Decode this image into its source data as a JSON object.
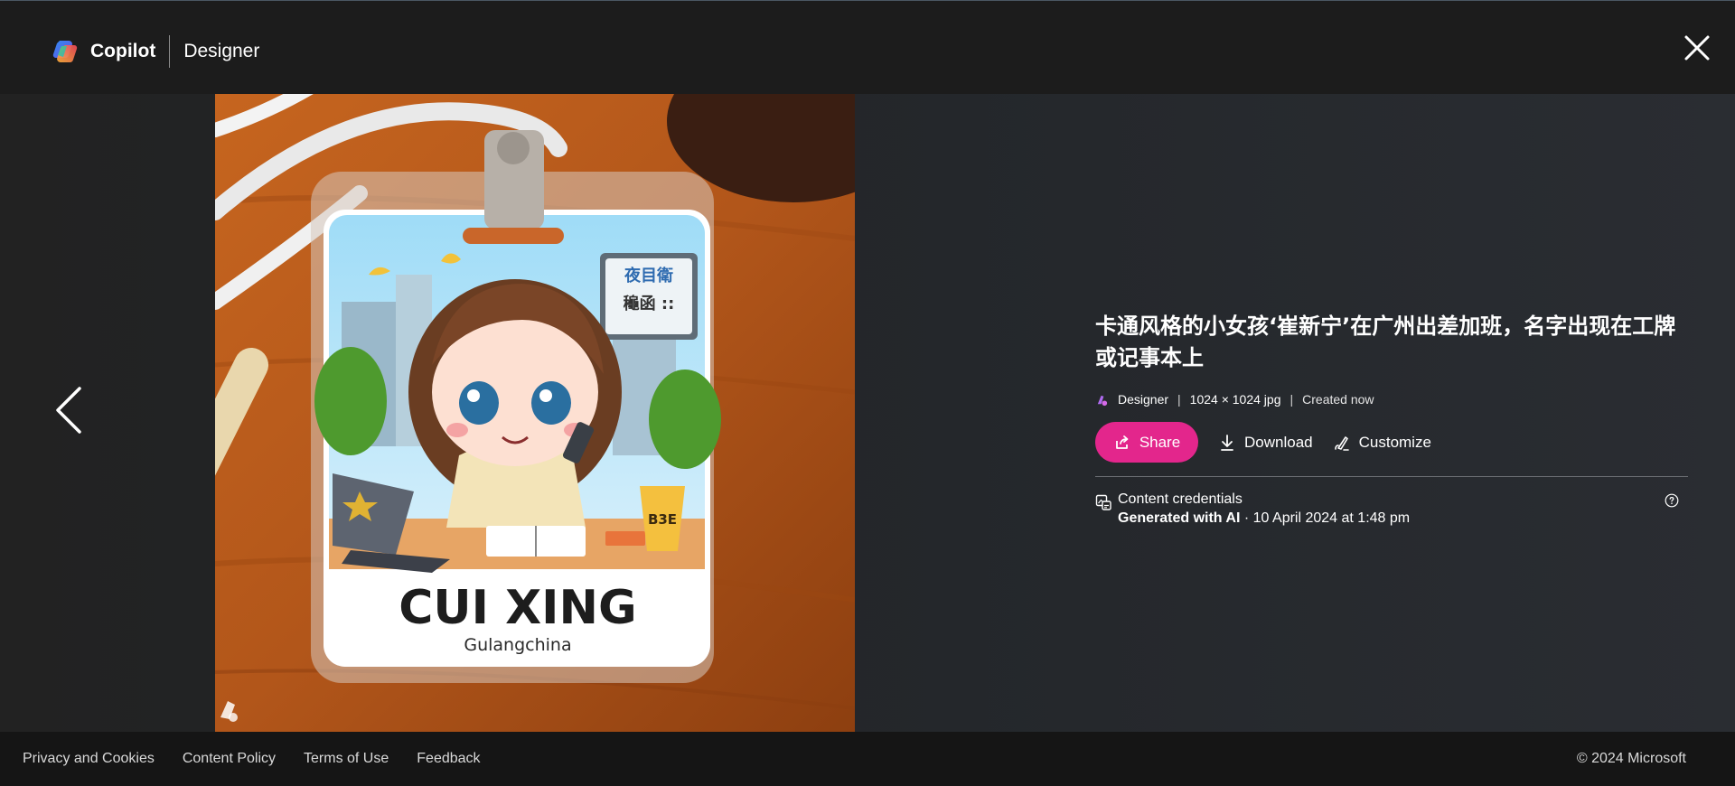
{
  "header": {
    "brand_name": "Copilot",
    "product_name": "Designer",
    "close_icon": "close-icon"
  },
  "navigation": {
    "prev_icon": "chevron-left-icon"
  },
  "image": {
    "badge_name": "CUI XING",
    "badge_subtitle": "Gulangchina",
    "sign_top": "夜目衛",
    "sign_bottom": "龝函 ::",
    "cup_text": "B3E",
    "watermark_icon": "designer-watermark-icon"
  },
  "details": {
    "title": "卡通风格的小女孩‘崔新宁’在广州出差加班，名字出现在工牌或记事本上",
    "source": "Designer",
    "dimensions": "1024 × 1024 jpg",
    "created": "Created now",
    "separator": "|"
  },
  "actions": {
    "share_label": "Share",
    "download_label": "Download",
    "customize_label": "Customize"
  },
  "credentials": {
    "title": "Content credentials",
    "generated": "Generated with AI",
    "date": " · 10 April 2024 at 1:48 pm"
  },
  "footer": {
    "links": [
      "Privacy and Cookies",
      "Content Policy",
      "Terms of Use",
      "Feedback"
    ],
    "copyright": "© 2024 Microsoft"
  },
  "colors": {
    "accent": "#e3268c",
    "header_bg": "#1c1c1c",
    "footer_bg": "#151515"
  }
}
